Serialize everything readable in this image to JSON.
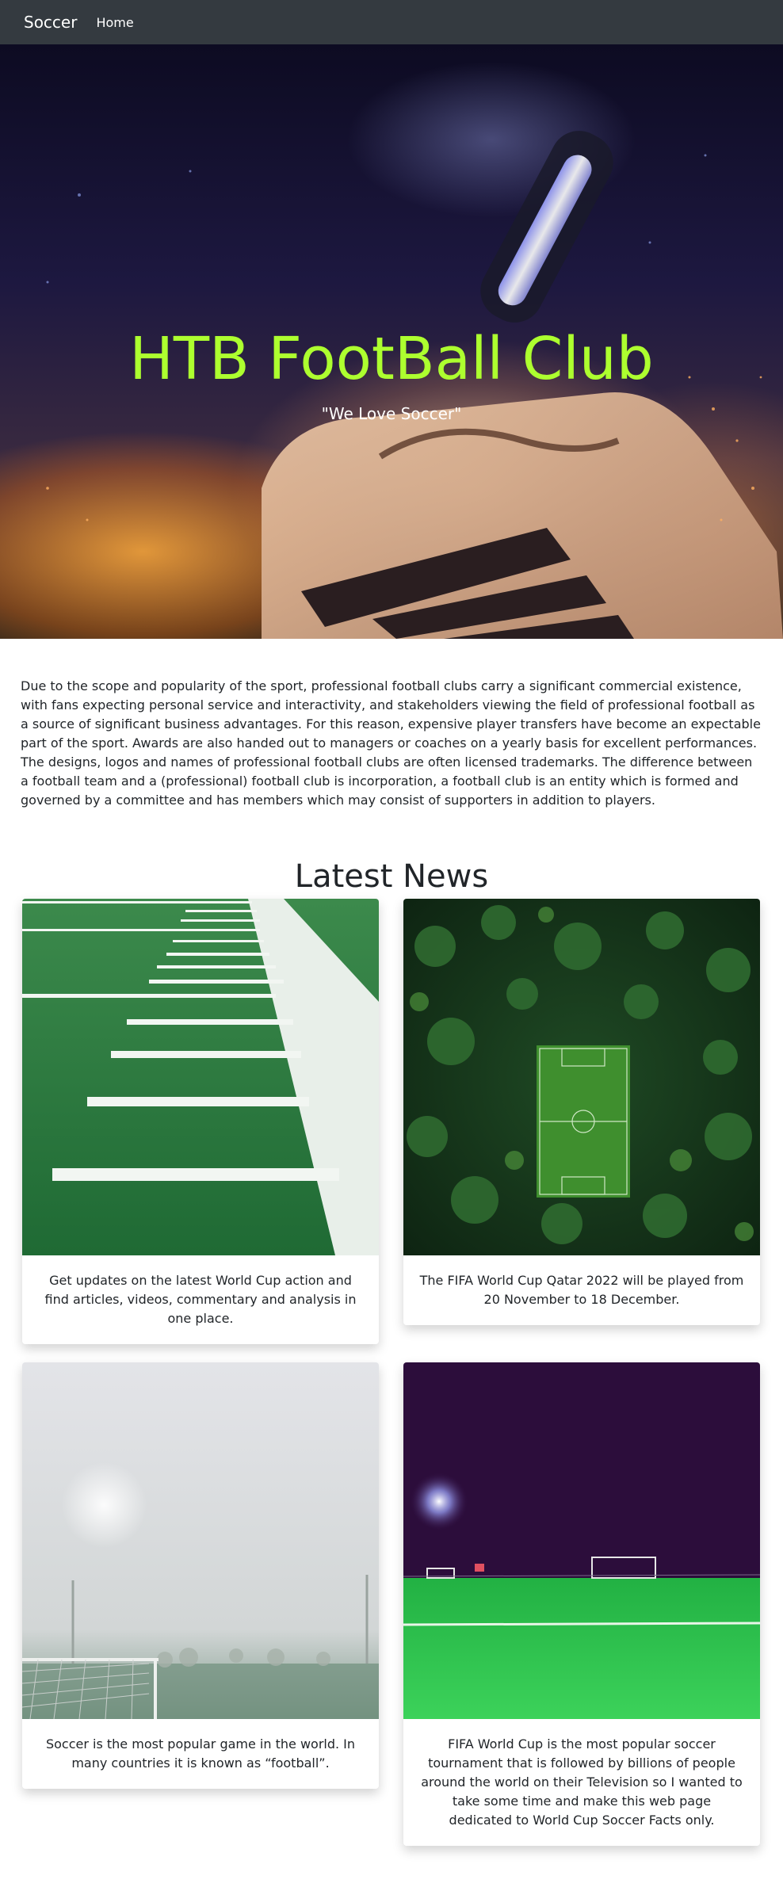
{
  "navbar": {
    "brand": "Soccer",
    "links": [
      {
        "label": "Home"
      }
    ]
  },
  "hero": {
    "title": "HTB FootBall Club",
    "subtitle": "\"We Love Soccer\""
  },
  "about": {
    "text": "Due to the scope and popularity of the sport, professional football clubs carry a significant commercial existence, with fans expecting personal service and interactivity, and stakeholders viewing the field of professional football as a source of significant business advantages. For this reason, expensive player transfers have become an expectable part of the sport. Awards are also handed out to managers or coaches on a yearly basis for excellent performances. The designs, logos and names of professional football clubs are often licensed trademarks. The difference between a football team and a (professional) football club is incorporation, a football club is an entity which is formed and governed by a committee and has members which may consist of supporters in addition to players."
  },
  "news": {
    "heading": "Latest News",
    "cards": [
      {
        "caption": "Get updates on the latest World Cup action and find articles, videos, commentary and analysis in one place."
      },
      {
        "caption": "The FIFA World Cup Qatar 2022 will be played from 20 November to 18 December."
      },
      {
        "caption": "Soccer is the most popular game in the world. In many countries it is known as “football”."
      },
      {
        "caption": "FIFA World Cup is the most popular soccer tournament that is followed by billions of people around the world on their Television so I wanted to take some time and make this web page dedicated to World Cup Soccer Facts only."
      }
    ]
  },
  "colors": {
    "navbar": "#343a40",
    "hero_title": "#adff2f",
    "text": "#212529"
  }
}
